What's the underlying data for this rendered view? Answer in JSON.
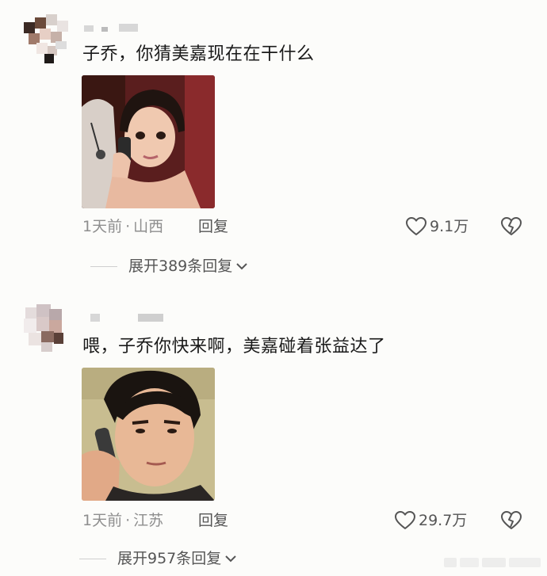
{
  "comments": [
    {
      "text": "子乔，你猜美嘉现在在干什么",
      "time": "1天前",
      "location": "山西",
      "reply_label": "回复",
      "likes": "9.1万",
      "expand_label": "展开389条回复"
    },
    {
      "text": "喂，子乔你快来啊，美嘉碰着张益达了",
      "time": "1天前",
      "location": "江苏",
      "reply_label": "回复",
      "likes": "29.7万",
      "expand_label": "展开957条回复"
    }
  ],
  "separator": "·",
  "colors": {
    "background": "#fcfcfa",
    "meta": "#8e8e8e",
    "text": "#1a1a1a"
  },
  "icons": [
    "heart-icon",
    "broken-heart-icon",
    "chevron-down-icon"
  ]
}
